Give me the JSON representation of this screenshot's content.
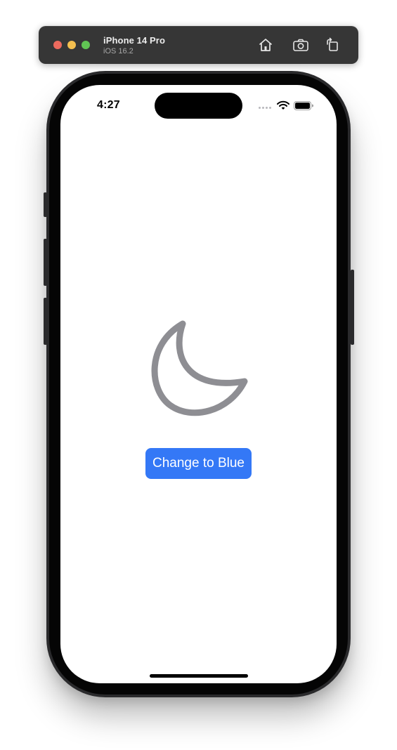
{
  "simulator": {
    "device_name": "iPhone 14 Pro",
    "os_version": "iOS 16.2",
    "toolbar_icons": [
      "home-icon",
      "screenshot-icon",
      "rotate-icon"
    ]
  },
  "status_bar": {
    "time": "4:27",
    "icons": [
      "cellular-dots-icon",
      "wifi-icon",
      "battery-icon"
    ]
  },
  "main": {
    "symbol": "moon-icon",
    "symbol_color": "#8e8e93",
    "button_label": "Change to Blue",
    "button_color": "#3478f6"
  },
  "colors": {
    "toolbar_bg": "#363636",
    "close": "#ec6a5e",
    "minimize": "#f4bf4f",
    "zoom": "#61c554"
  }
}
